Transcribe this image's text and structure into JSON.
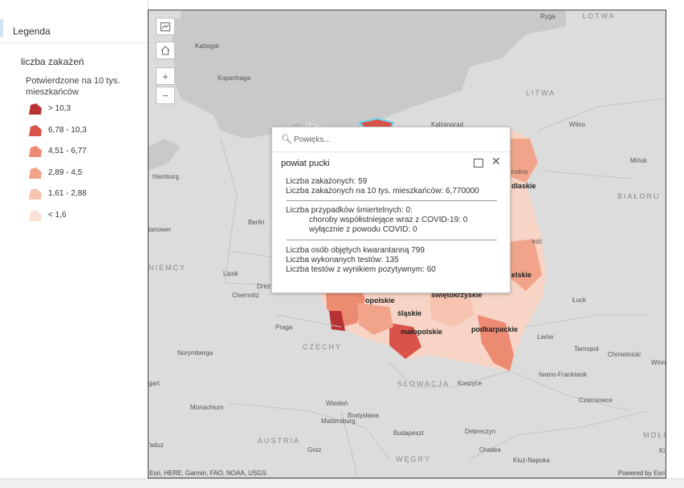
{
  "legend": {
    "title": "Legenda",
    "layer_name": "liczba zakażeń",
    "field_label": "Potwierdzone na 10 tys. mieszkańców",
    "items": [
      {
        "label": "> 10,3",
        "color": "#b83234"
      },
      {
        "label": "6,78 - 10,3",
        "color": "#d9534a"
      },
      {
        "label": "4,51 - 6,77",
        "color": "#ec8a72"
      },
      {
        "label": "2,89 - 4,5",
        "color": "#f1a48a"
      },
      {
        "label": "1,61 - 2,88",
        "color": "#f6c4b0"
      },
      {
        "label": "< 1,6",
        "color": "#fbe2d6"
      }
    ]
  },
  "map_controls": {
    "basemap_icon": "basemap-icon",
    "home_icon": "home-icon",
    "zoom_in": "+",
    "zoom_out": "−"
  },
  "map_labels": {
    "ryga": "Ryga",
    "lotwa": "ŁOTWA",
    "kattegat": "Kattegat",
    "kopenhaga": "Kopenhaga",
    "litwa": "LITWA",
    "morze": "Morze",
    "kaliningrad": "Kaliningrad",
    "wilno": "Wilno",
    "hamburg": "Hamburg",
    "grodno": "rodno",
    "podlaskie": "dlaskie",
    "minsk": "Mińsk",
    "bialorus": "BIAŁORU",
    "berlin": "Berlin",
    "hanower": "lanower",
    "niemcy": "NIEMCY",
    "lipsk": "Lipsk",
    "drezno": "Drez",
    "chemnitz": "Chemnitz",
    "lubelskie": "elskie",
    "brzesc": "eść",
    "luck": "Łuck",
    "opolskie": "opolskie",
    "swietokrzyskie": "świętokrzyskie",
    "slaskie": "śląskie",
    "malopolskie": "małopolskie",
    "podkarpackie": "podkarpackie",
    "praga": "Praga",
    "lwow": "Lwów",
    "norymberga": "Norymberga",
    "czechy": "CZECHY",
    "tarnopol": "Tarnopol",
    "chmielnicki": "Chmielnicki",
    "winnica": "Winn",
    "iwano": "Iwano-Frankiwsk",
    "gart": "gart",
    "slowacja": "SŁOWACJA",
    "koszyce": "Koszyce",
    "czerniowce": "Czerniowce",
    "monachium": "Monachium",
    "wieden": "Wiedeń",
    "mattersburg": "Mattersburg",
    "bratyslawa": "Bratysława",
    "moldawia": "MOŁDA",
    "austria": "AUSTRIA",
    "budapeszt": "Budapeszt",
    "debreczyn": "Debreczyn",
    "graz": "Graz",
    "oradea": "Oradea",
    "padwa": "'aduz",
    "wegry": "WĘGRY",
    "kluz": "Kluż-Napoka",
    "ki": "Ki"
  },
  "attribution": "Esri, HERE, Garmin, FAO, NOAA, USGS",
  "powered_by": "Powered by Esri",
  "popup": {
    "search_placeholder": "Powięks...",
    "title": "powiat pucki",
    "line1": "Liczba zakażonych: 59",
    "line2": "Liczba zakażonych na 10 tys. mieszkańców: 6,770000",
    "line3": "Liczba przypadków śmiertelnych: 0:",
    "line4": "choroby współistniejące wraz z COVID-19: 0",
    "line5": "wyłącznie z powodu COVID: 0",
    "line6": "Liczba osób objętych kwarantanną 799",
    "line7": "Liczba wykonanych testów: 135",
    "line8": "Liczba testów z wynikiem pozytywnym: 60"
  }
}
